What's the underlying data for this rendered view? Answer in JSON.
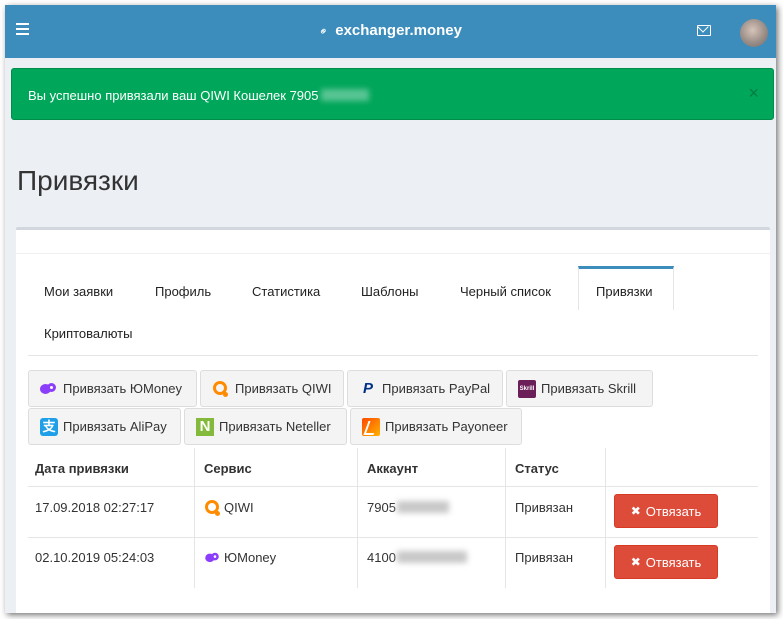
{
  "header": {
    "brand": "exchanger.money",
    "icons": {
      "menu": "menu-icon",
      "link": "link-icon",
      "mail": "mail-icon",
      "avatar": "avatar"
    },
    "color": "#3c8dbc"
  },
  "alert": {
    "message": "Вы успешно привязали ваш QIWI Кошелек 7905",
    "close": "×",
    "color": "#00a65a"
  },
  "page": {
    "title": "Привязки"
  },
  "tabs": [
    {
      "label": "Мои заявки"
    },
    {
      "label": "Профиль"
    },
    {
      "label": "Статистика"
    },
    {
      "label": "Шаблоны"
    },
    {
      "label": "Черный список"
    },
    {
      "label": "Привязки",
      "active": true
    },
    {
      "label": "Криптовалюты"
    }
  ],
  "services": [
    {
      "label": "Привязать ЮMoney",
      "icon": "yoomoney-icon"
    },
    {
      "label": "Привязать QIWI",
      "icon": "qiwi-icon"
    },
    {
      "label": "Привязать PayPal",
      "icon": "paypal-icon",
      "glyph": "P"
    },
    {
      "label": "Привязать Skrill",
      "icon": "skrill-icon",
      "glyph": "Skrill"
    },
    {
      "label": "Привязать AliPay",
      "icon": "alipay-icon",
      "glyph": "支"
    },
    {
      "label": "Привязать Neteller",
      "icon": "neteller-icon",
      "glyph": "N"
    },
    {
      "label": "Привязать Payoneer",
      "icon": "payoneer-icon"
    }
  ],
  "table": {
    "headers": [
      "Дата привязки",
      "Сервис",
      "Аккаунт",
      "Статус"
    ],
    "rows": [
      {
        "date": "17.09.2018 02:27:17",
        "service": "QIWI",
        "service_icon": "qiwi-icon",
        "account": "7905",
        "status": "Привязан",
        "action": "Отвязать"
      },
      {
        "date": "02.10.2019 05:24:03",
        "service": "ЮMoney",
        "service_icon": "yoomoney-icon",
        "account": "4100",
        "status": "Привязан",
        "action": "Отвязать"
      }
    ],
    "action_color": "#dd4b39"
  }
}
